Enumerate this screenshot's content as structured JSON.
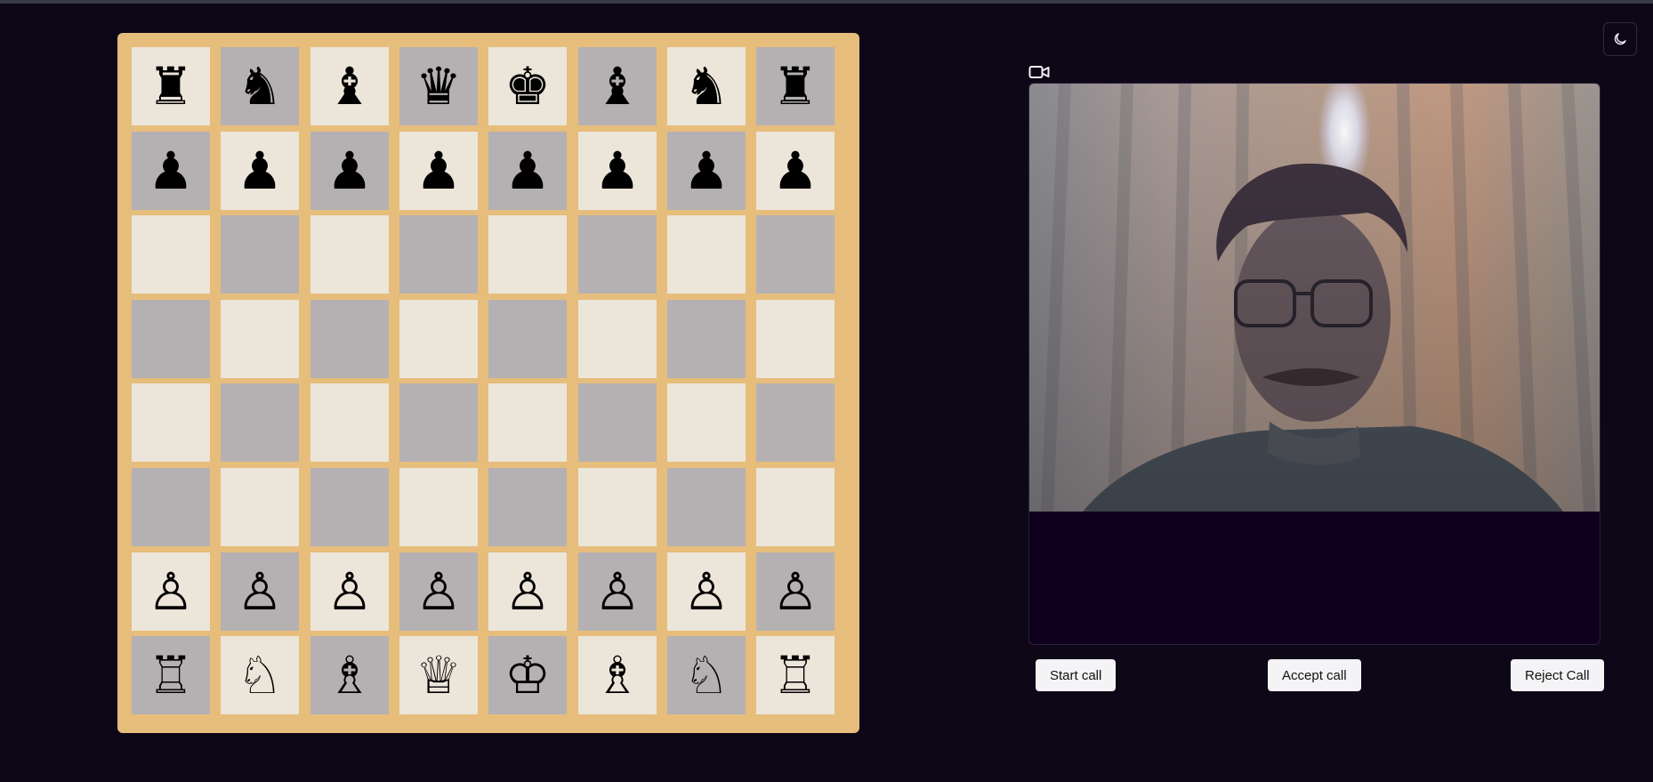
{
  "board": {
    "rows": [
      [
        "♜",
        "♞",
        "♝",
        "♛",
        "♚",
        "♝",
        "♞",
        "♜"
      ],
      [
        "♟",
        "♟",
        "♟",
        "♟",
        "♟",
        "♟",
        "♟",
        "♟"
      ],
      [
        "",
        "",
        "",
        "",
        "",
        "",
        "",
        ""
      ],
      [
        "",
        "",
        "",
        "",
        "",
        "",
        "",
        ""
      ],
      [
        "",
        "",
        "",
        "",
        "",
        "",
        "",
        ""
      ],
      [
        "",
        "",
        "",
        "",
        "",
        "",
        "",
        ""
      ],
      [
        "♙",
        "♙",
        "♙",
        "♙",
        "♙",
        "♙",
        "♙",
        "♙"
      ],
      [
        "♖",
        "♘",
        "♗",
        "♕",
        "♔",
        "♗",
        "♘",
        "♖"
      ]
    ],
    "piece_names": {
      "♜": "black-rook",
      "♞": "black-knight",
      "♝": "black-bishop",
      "♛": "black-queen",
      "♚": "black-king",
      "♟": "black-pawn",
      "♖": "white-rook",
      "♘": "white-knight",
      "♗": "white-bishop",
      "♕": "white-queen",
      "♔": "white-king",
      "♙": "white-pawn"
    },
    "colors": {
      "frame": "#e6bd7b",
      "light": "#ece5da",
      "dark": "#b5b1b2"
    }
  },
  "icons": {
    "theme_toggle": "moon-icon",
    "camera": "video-camera-icon"
  },
  "call": {
    "start_label": "Start call",
    "accept_label": "Accept call",
    "reject_label": "Reject Call"
  },
  "colors": {
    "background": "#0d0718",
    "video_panel": "#10001f",
    "button": "#f4f4f6"
  }
}
